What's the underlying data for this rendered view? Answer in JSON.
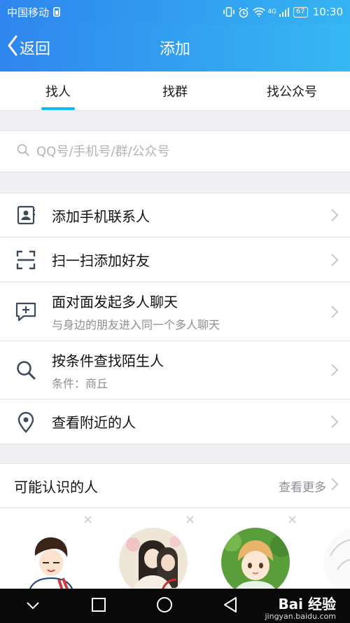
{
  "statusbar": {
    "carrier": "中国移动",
    "network": "4G",
    "battery": "67",
    "time": "10:30"
  },
  "navbar": {
    "back_label": "返回",
    "title": "添加"
  },
  "tabs": [
    {
      "label": "找人",
      "active": true
    },
    {
      "label": "找群",
      "active": false
    },
    {
      "label": "找公众号",
      "active": false
    }
  ],
  "search": {
    "placeholder": "QQ号/手机号/群/公众号"
  },
  "options": [
    {
      "icon": "contacts-icon",
      "label": "添加手机联系人",
      "sub": ""
    },
    {
      "icon": "scan-icon",
      "label": "扫一扫添加好友",
      "sub": ""
    },
    {
      "icon": "chat-plus-icon",
      "label": "面对面发起多人聊天",
      "sub": "与身边的朋友进入同一个多人聊天"
    },
    {
      "icon": "search-icon",
      "label": "按条件查找陌生人",
      "sub": "条件：商丘"
    },
    {
      "icon": "location-icon",
      "label": "查看附近的人",
      "sub": ""
    }
  ],
  "suggestions": {
    "title": "可能认识的人",
    "more_label": "查看更多",
    "close_glyph": "×"
  },
  "watermark": {
    "brand": "Bai 经验",
    "url": "jingyan.baidu.com"
  },
  "colors": {
    "header_start": "#2f86ee",
    "header_end": "#36b8f3",
    "tab_indicator": "#12b7f5",
    "icon": "#3d4a5c"
  }
}
